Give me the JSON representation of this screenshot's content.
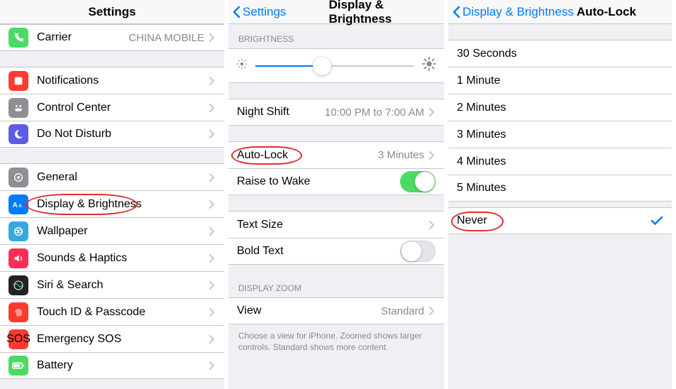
{
  "panel1": {
    "title": "Settings",
    "group1": [
      {
        "name": "carrier",
        "label": "Carrier",
        "detail": "CHINA MOBILE",
        "iconColor": "#4cd964",
        "iconName": "phone-icon"
      }
    ],
    "group2": [
      {
        "name": "notifications",
        "label": "Notifications",
        "iconColor": "#ff3b30",
        "iconName": "notifications-icon"
      },
      {
        "name": "control-center",
        "label": "Control Center",
        "iconColor": "#8e8e93",
        "iconName": "control-center-icon"
      },
      {
        "name": "do-not-disturb",
        "label": "Do Not Disturb",
        "iconColor": "#5e5ce6",
        "iconName": "moon-icon"
      }
    ],
    "group3": [
      {
        "name": "general",
        "label": "General",
        "iconColor": "#8e8e93",
        "iconName": "gear-icon"
      },
      {
        "name": "display-brightness",
        "label": "Display & Brightness",
        "iconColor": "#007aff",
        "iconName": "text-size-icon",
        "circled": true
      },
      {
        "name": "wallpaper",
        "label": "Wallpaper",
        "iconColor": "#34aadc",
        "iconName": "wallpaper-icon"
      },
      {
        "name": "sounds-haptics",
        "label": "Sounds & Haptics",
        "iconColor": "#ff2d55",
        "iconName": "sound-icon"
      },
      {
        "name": "siri-search",
        "label": "Siri & Search",
        "iconColor": "#222222",
        "iconName": "siri-icon"
      },
      {
        "name": "touch-id-passcode",
        "label": "Touch ID & Passcode",
        "iconColor": "#ff3b30",
        "iconName": "fingerprint-icon"
      },
      {
        "name": "emergency-sos",
        "label": "Emergency SOS",
        "iconColor": "#ff3b30",
        "iconName": "sos-icon"
      },
      {
        "name": "battery",
        "label": "Battery",
        "iconColor": "#4cd964",
        "iconName": "battery-icon"
      }
    ]
  },
  "panel2": {
    "back": "Settings",
    "title": "Display & Brightness",
    "brightness_header": "BRIGHTNESS",
    "slider_value_percent": 42,
    "rows_a": [
      {
        "name": "night-shift",
        "label": "Night Shift",
        "detail": "10:00 PM to 7:00 AM",
        "type": "chevron"
      }
    ],
    "rows_b": [
      {
        "name": "auto-lock",
        "label": "Auto-Lock",
        "detail": "3 Minutes",
        "type": "chevron",
        "circled": true
      },
      {
        "name": "raise-to-wake",
        "label": "Raise to Wake",
        "type": "toggle",
        "toggle_on": true
      }
    ],
    "rows_c": [
      {
        "name": "text-size",
        "label": "Text Size",
        "type": "chevron"
      },
      {
        "name": "bold-text",
        "label": "Bold Text",
        "type": "toggle",
        "toggle_on": false
      }
    ],
    "display_zoom_header": "DISPLAY ZOOM",
    "rows_d": [
      {
        "name": "view",
        "label": "View",
        "detail": "Standard",
        "type": "chevron"
      }
    ],
    "display_zoom_footer": "Choose a view for iPhone. Zoomed shows larger controls. Standard shows more content."
  },
  "panel3": {
    "back": "Display & Brightness",
    "title": "Auto-Lock",
    "options": [
      {
        "label": "30 Seconds",
        "checked": false
      },
      {
        "label": "1 Minute",
        "checked": false
      },
      {
        "label": "2 Minutes",
        "checked": false
      },
      {
        "label": "3 Minutes",
        "checked": false
      },
      {
        "label": "4 Minutes",
        "checked": false
      },
      {
        "label": "5 Minutes",
        "checked": false
      }
    ],
    "options_b": [
      {
        "label": "Never",
        "checked": true,
        "circled": true
      }
    ]
  }
}
